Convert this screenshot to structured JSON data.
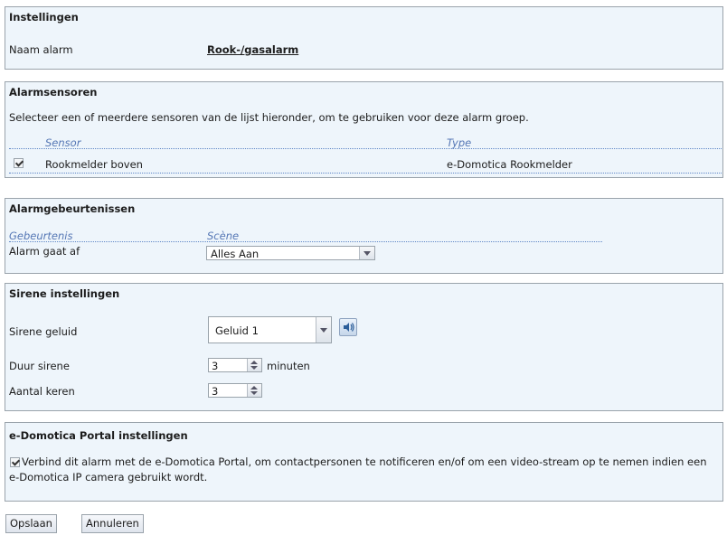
{
  "settings": {
    "title": "Instellingen",
    "alarm_name_label": "Naam alarm",
    "alarm_name_value": "Rook-/gasalarm"
  },
  "sensors": {
    "title": "Alarmsensoren",
    "description": "Selecteer een of meerdere sensoren van de lijst hieronder, om te gebruiken voor deze alarm groep.",
    "col_sensor": "Sensor",
    "col_type": "Type",
    "rows": [
      {
        "checked": true,
        "sensor": "Rookmelder boven",
        "type": "e-Domotica Rookmelder"
      }
    ]
  },
  "events": {
    "title": "Alarmgebeurtenissen",
    "col_event": "Gebeurtenis",
    "col_scene": "Scène",
    "rows": [
      {
        "event": "Alarm gaat af",
        "scene": "Alles Aan"
      }
    ]
  },
  "siren": {
    "title": "Sirene instellingen",
    "sound_label": "Sirene geluid",
    "sound_value": "Geluid 1",
    "duration_label": "Duur sirene",
    "duration_value": "3",
    "duration_unit": "minuten",
    "count_label": "Aantal keren",
    "count_value": "3"
  },
  "portal": {
    "title": "e-Domotica Portal instellingen",
    "checked": true,
    "text": "Verbind dit alarm met de e-Domotica Portal, om contactpersonen te notificeren en/of om een video-stream op te nemen indien een e-Domotica IP camera gebruikt wordt."
  },
  "buttons": {
    "save": "Opslaan",
    "cancel": "Annuleren"
  },
  "icons": {
    "speaker": "speaker-icon",
    "checkbox": "checkmark-icon"
  }
}
